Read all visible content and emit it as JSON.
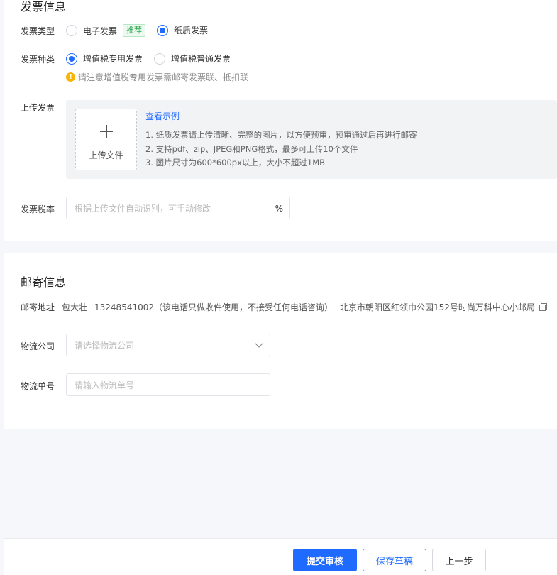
{
  "invoice": {
    "title": "发票信息",
    "type_label": "发票类型",
    "type_options": [
      {
        "label": "电子发票",
        "tag": "推荐",
        "selected": false
      },
      {
        "label": "纸质发票",
        "selected": true
      }
    ],
    "kind_label": "发票种类",
    "kind_options": [
      {
        "label": "增值税专用发票",
        "selected": true
      },
      {
        "label": "增值税普通发票",
        "selected": false
      }
    ],
    "warning": "请注意增值税专用发票需邮寄发票联、抵扣联",
    "upload_label": "上传发票",
    "upload_button": "上传文件",
    "example_link": "查看示例",
    "notes": [
      "1. 纸质发票请上传清晰、完整的图片，以方便预审，预审通过后再进行邮寄",
      "2. 支持pdf、zip、JPEG和PNG格式，最多可上传10个文件",
      "3. 图片尺寸为600*600px以上，大小不超过1MB"
    ],
    "tax_label": "发票税率",
    "tax_placeholder": "根据上传文件自动识别，可手动修改",
    "tax_suffix": "%"
  },
  "mail": {
    "title": "邮寄信息",
    "address_label": "邮寄地址",
    "recipient": "包大壮",
    "phone": "13248541002（该电话只做收件使用，不接受任何电话咨询）",
    "address": "北京市朝阳区红领巾公园152号时尚万科中心小邮局",
    "courier_label": "物流公司",
    "courier_placeholder": "请选择物流公司",
    "tracking_label": "物流单号",
    "tracking_placeholder": "请输入物流单号"
  },
  "footer": {
    "submit": "提交审核",
    "save_draft": "保存草稿",
    "prev": "上一步"
  },
  "colors": {
    "primary": "#1f6bff",
    "tag_green": "#2fa84f",
    "warning": "#f7b500"
  }
}
